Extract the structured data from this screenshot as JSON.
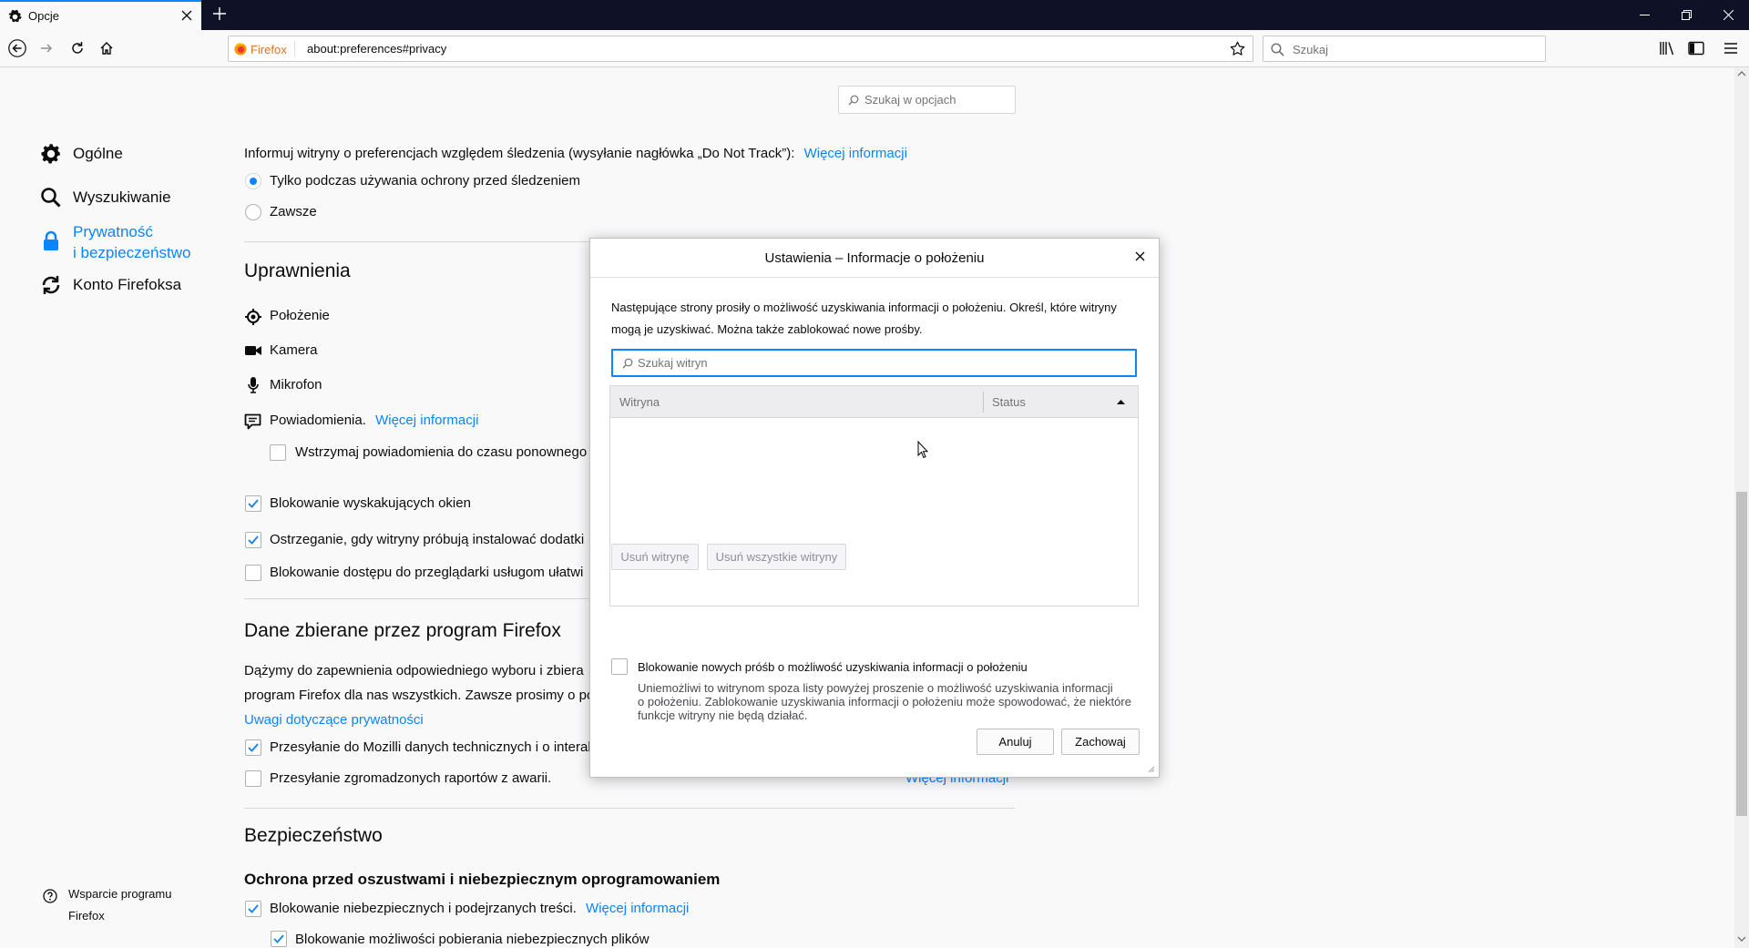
{
  "browser": {
    "tab_title": "Opcje",
    "url_identity": "Firefox",
    "url": "about:preferences#privacy",
    "search_placeholder": "Szukaj"
  },
  "sidebar": {
    "items": [
      {
        "label": "Ogólne"
      },
      {
        "label": "Wyszukiwanie"
      },
      {
        "label_line1": "Prywatność",
        "label_line2": "i bezpieczeństwo"
      },
      {
        "label": "Konto Firefoksa"
      }
    ],
    "support_line1": "Wsparcie programu",
    "support_line2": "Firefox"
  },
  "prefs": {
    "search_placeholder": "Szukaj w opcjach",
    "dnt_text": "Informuj witryny o preferencjach względem śledzenia (wysyłanie nagłówka „Do Not Track”):",
    "more_info": "Więcej informacji",
    "dnt_option1": "Tylko podczas używania ochrony przed śledzeniem",
    "dnt_option2": "Zawsze",
    "permissions_heading": "Uprawnienia",
    "perm_location": "Położenie",
    "perm_camera": "Kamera",
    "perm_microphone": "Mikrofon",
    "perm_notifications": "Powiadomienia.",
    "pause_notifications": "Wstrzymaj powiadomienia do czasu ponownego",
    "block_popups": "Blokowanie wyskakujących okien",
    "warn_addons": "Ostrzeganie, gdy witryny próbują instalować dodatki",
    "block_accessibility": "Blokowanie dostępu do przeglądarki usługom ułatwi",
    "data_heading": "Dane zbierane przez program Firefox",
    "data_text1": "Dążymy do zapewnienia odpowiedniego wyboru i zbiera",
    "data_text2": "program Firefox dla nas wszystkich. Zawsze prosimy o poz",
    "privacy_notes": "Uwagi dotyczące prywatności",
    "send_technical": "Przesyłanie do Mozilli danych technicznych i o interak",
    "send_crash": "Przesyłanie zgromadzonych raportów z awarii.",
    "security_heading": "Bezpieczeństwo",
    "fraud_heading": "Ochrona przed oszustwami i niebezpiecznym oprogramowaniem",
    "block_dangerous": "Blokowanie niebezpiecznych i podejrzanych treści.",
    "block_downloads": "Blokowanie możliwości pobierania niebezpiecznych plików"
  },
  "dialog": {
    "title": "Ustawienia – Informacje o położeniu",
    "desc_line1": "Następujące strony prosiły o możliwość uzyskiwania informacji o położeniu. Określ, które witryny",
    "desc_line2": "mogą je uzyskiwać. Można także zablokować nowe prośby.",
    "search_placeholder": "Szukaj witryn",
    "col_site": "Witryna",
    "col_status": "Status",
    "remove_site": "Usuń witrynę",
    "remove_all": "Usuń wszystkie witryny",
    "block_new": "Blokowanie nowych próśb o możliwość uzyskiwania informacji o położeniu",
    "block_desc_line1": "Uniemożliwi to witrynom spoza listy powyżej proszenie o możliwość uzyskiwania informacji",
    "block_desc_line2": "o położeniu. Zablokowanie uzyskiwania informacji o położeniu może spowodować, że niektóre",
    "block_desc_line3": "funkcje witryny nie będą działać.",
    "cancel": "Anuluj",
    "save": "Zachowaj"
  },
  "colors": {
    "accent": "#0a84ff",
    "titlebar": "#0f1126",
    "background": "#f9f9fa"
  }
}
